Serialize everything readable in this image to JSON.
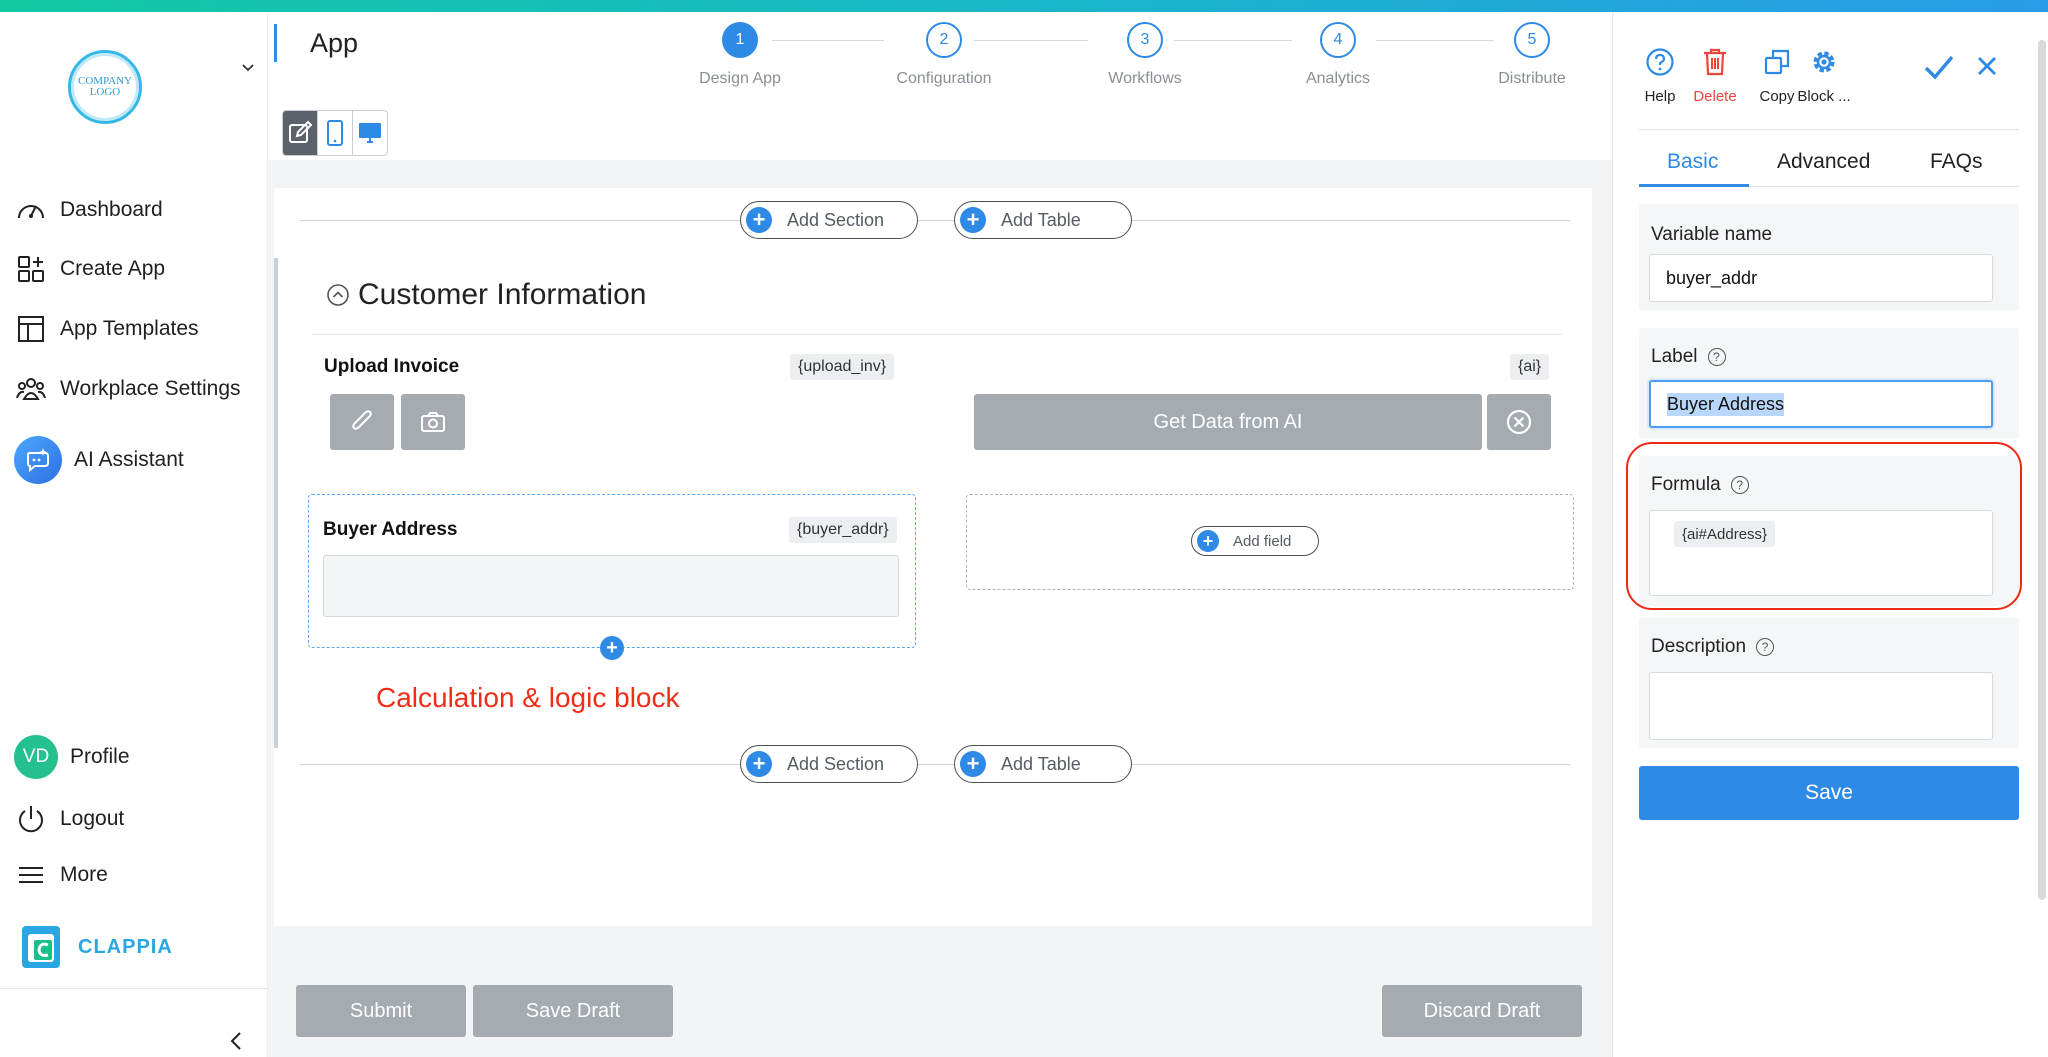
{
  "app": {
    "title": "App"
  },
  "logo": {
    "line1": "COMPANY",
    "line2": "LOGO"
  },
  "sidebar": {
    "items": [
      {
        "label": "Dashboard",
        "icon": "gauge-icon"
      },
      {
        "label": "Create App",
        "icon": "grid-plus-icon"
      },
      {
        "label": "App Templates",
        "icon": "layout-icon"
      },
      {
        "label": "Workplace Settings",
        "icon": "users-icon"
      },
      {
        "label": "AI Assistant",
        "icon": "ai-assistant-icon"
      }
    ],
    "bottom_items": [
      {
        "label": "Profile",
        "avatar_initials": "VD"
      },
      {
        "label": "Logout",
        "icon": "power-icon"
      },
      {
        "label": "More",
        "icon": "menu-icon"
      }
    ],
    "brand": "CLAPPIA"
  },
  "steps": [
    {
      "number": "1",
      "label": "Design App",
      "active": true
    },
    {
      "number": "2",
      "label": "Configuration",
      "active": false
    },
    {
      "number": "3",
      "label": "Workflows",
      "active": false
    },
    {
      "number": "4",
      "label": "Analytics",
      "active": false
    },
    {
      "number": "5",
      "label": "Distribute",
      "active": false
    }
  ],
  "canvas": {
    "add_section": "Add Section",
    "add_table": "Add Table",
    "section_title": "Customer Information",
    "upload_label": "Upload Invoice",
    "upload_var": "{upload_inv}",
    "ai_var": "{ai}",
    "ai_button": "Get Data from AI",
    "buyer_label": "Buyer Address",
    "buyer_var": "{buyer_addr}",
    "add_field": "Add field",
    "annotation": "Calculation & logic block"
  },
  "footer": {
    "submit": "Submit",
    "save_draft": "Save Draft",
    "discard_draft": "Discard Draft"
  },
  "panel": {
    "tools": [
      {
        "label": "Help",
        "icon": "help-icon"
      },
      {
        "label": "Delete",
        "icon": "trash-icon"
      },
      {
        "label": "Copy",
        "icon": "copy-icon"
      },
      {
        "label": "Block ...",
        "icon": "gear-icon"
      }
    ],
    "tabs": [
      "Basic",
      "Advanced",
      "FAQs"
    ],
    "variable_name_label": "Variable name",
    "variable_name_value": "buyer_addr",
    "label_label": "Label",
    "label_value": "Buyer Address",
    "formula_label": "Formula",
    "formula_chip": "{ai#Address}",
    "description_label": "Description",
    "description_value": "",
    "save": "Save"
  },
  "colors": {
    "accent": "#2f8ae5",
    "delete": "#f0433a",
    "annotation": "#f12d18",
    "disabled_button": "#a6aab1",
    "brand": "#2aa6e2"
  }
}
